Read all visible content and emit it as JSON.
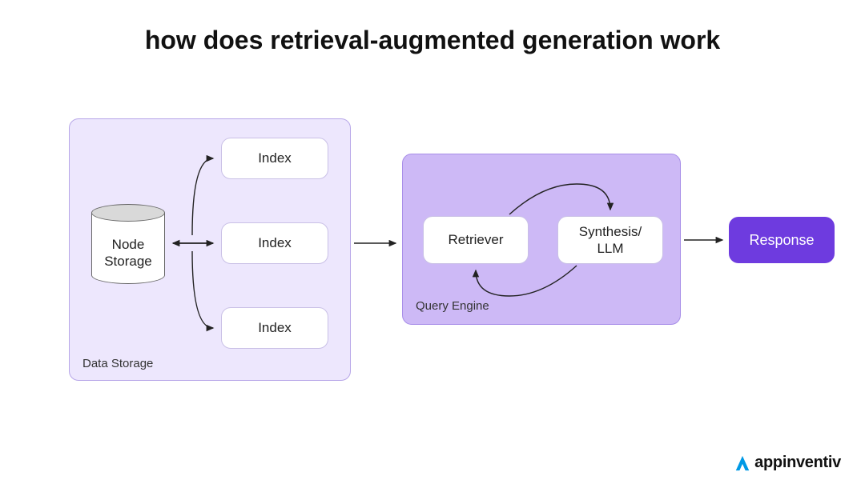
{
  "title": "how does retrieval-augmented generation work",
  "dataStorage": {
    "label": "Data Storage",
    "nodeStorage": "Node\nStorage",
    "indexes": [
      "Index",
      "Index",
      "Index"
    ]
  },
  "queryEngine": {
    "label": "Query Engine",
    "retriever": "Retriever",
    "synthesis": "Synthesis/\nLLM"
  },
  "response": "Response",
  "brand": "appinventiv",
  "colors": {
    "lightPanel": "#EDE7FD",
    "mediumPanel": "#CDB9F6",
    "accent": "#6E3BDF",
    "brandBlue": "#0099E5"
  }
}
